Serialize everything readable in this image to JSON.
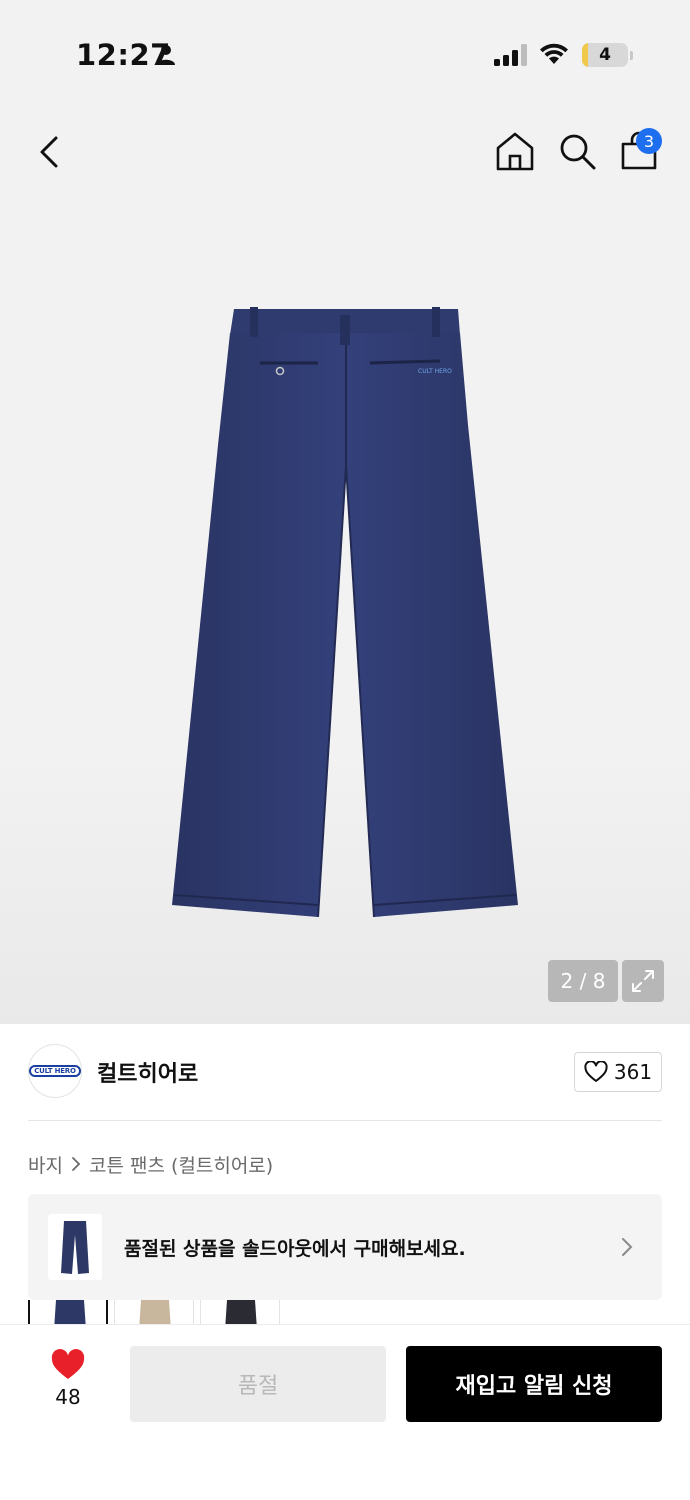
{
  "status_bar": {
    "time": "12:27",
    "battery_level": "4",
    "icons": [
      "person-icon",
      "signal-icon",
      "wifi-icon",
      "battery-icon"
    ]
  },
  "nav": {
    "icons": [
      "back-arrow-icon",
      "home-icon",
      "search-icon",
      "shopping-bag-icon"
    ],
    "cart_count": "3"
  },
  "gallery": {
    "counter": "2 / 8",
    "current_index": 2,
    "total": 8,
    "expand_icon": "expand-icon"
  },
  "brand": {
    "name": "컬트히어로",
    "logo_text": "CULT HERO",
    "like_count": "361"
  },
  "breadcrumb": {
    "items": [
      "바지",
      "코튼 팬츠 (컬트히어로)"
    ]
  },
  "soldout_banner": {
    "text": "품절된 상품을 솔드아웃에서 구매해보세요."
  },
  "color_options": [
    "navy",
    "beige",
    "black"
  ],
  "bottom_bar": {
    "wish_count": "48",
    "soldout_label": "품절",
    "restock_label": "재입고 알림 신청"
  },
  "colors": {
    "accent_blue": "#1e6ef0",
    "wish_red": "#e8202a",
    "denim_navy": "#2d3866",
    "primary_button": "#000000",
    "disabled_button": "#ececec"
  }
}
